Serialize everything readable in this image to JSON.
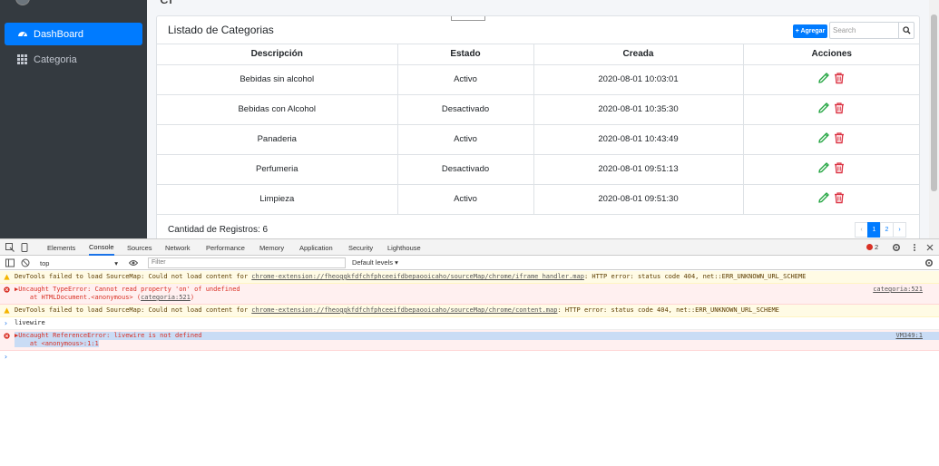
{
  "sidebar": {
    "items": [
      {
        "label": "DashBoard",
        "icon": "dashboard-icon",
        "active": true
      },
      {
        "label": "Categoria",
        "icon": "grid-icon",
        "active": false
      }
    ]
  },
  "card": {
    "title": "Listado de Categorias",
    "add_button": "+ Agregar",
    "search_placeholder": "Search",
    "columns": [
      "Descripción",
      "Estado",
      "Creada",
      "Acciones"
    ],
    "rows": [
      {
        "descripcion": "Bebidas sin alcohol",
        "estado": "Activo",
        "creada": "2020-08-01 10:03:01"
      },
      {
        "descripcion": "Bebidas con Alcohol",
        "estado": "Desactivado",
        "creada": "2020-08-01 10:35:30"
      },
      {
        "descripcion": "Panaderia",
        "estado": "Activo",
        "creada": "2020-08-01 10:43:49"
      },
      {
        "descripcion": "Perfumeria",
        "estado": "Desactivado",
        "creada": "2020-08-01 09:51:13"
      },
      {
        "descripcion": "Limpieza",
        "estado": "Activo",
        "creada": "2020-08-01 09:51:30"
      }
    ],
    "footer_text": "Cantidad de Registros: 6",
    "pagination": {
      "prev": "‹",
      "pages": [
        "1",
        "2"
      ],
      "next": "›",
      "current": "1"
    }
  },
  "colors": {
    "primary": "#007bff",
    "edit": "#28a745",
    "delete": "#dc3545",
    "sidebar": "#343a40"
  },
  "devtools": {
    "tabs": [
      "Elements",
      "Console",
      "Sources",
      "Network",
      "Performance",
      "Memory",
      "Application",
      "Security",
      "Lighthouse"
    ],
    "active_tab": "Console",
    "error_count": "2",
    "context": "top",
    "filter_placeholder": "Filter",
    "levels": "Default levels ▾",
    "messages": [
      {
        "type": "warn",
        "text": "DevTools failed to load SourceMap: Could not load content for ",
        "link": "chrome-extension://fheoggkfdfchfphceeifdbepaooicaho/sourceMap/chrome/iframe_handler.map",
        "tail": ": HTTP error: status code 404, net::ERR_UNKNOWN_URL_SCHEME"
      },
      {
        "type": "error",
        "text": "▶Uncaught TypeError: Cannot read property 'on' of undefined",
        "line2": "    at HTMLDocument.<anonymous> (",
        "line2_link": "categoria:521",
        "line2_tail": ")",
        "source": "categoria:521"
      },
      {
        "type": "warn",
        "text": "DevTools failed to load SourceMap: Could not load content for ",
        "link": "chrome-extension://fheoggkfdfchfphceeifdbepaooicaho/sourceMap/chrome/content.map",
        "tail": ": HTTP error: status code 404, net::ERR_UNKNOWN_URL_SCHEME"
      },
      {
        "type": "plain",
        "text": "livewire"
      },
      {
        "type": "error",
        "text": "▶Uncaught ReferenceError: livewire is not defined",
        "line2": "    at <anonymous>:1:1",
        "source": "VM349:1"
      }
    ]
  }
}
